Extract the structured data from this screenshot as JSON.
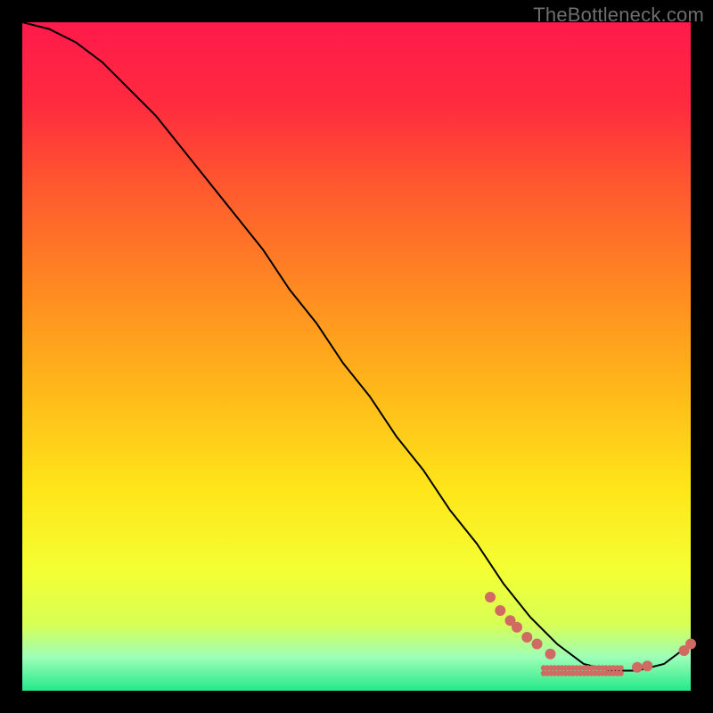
{
  "watermark": "TheBottleneck.com",
  "gradient": {
    "stops": [
      {
        "offset": 0.0,
        "color": "#ff1a4b"
      },
      {
        "offset": 0.12,
        "color": "#ff2a3f"
      },
      {
        "offset": 0.25,
        "color": "#ff5a2e"
      },
      {
        "offset": 0.4,
        "color": "#ff8a22"
      },
      {
        "offset": 0.55,
        "color": "#ffb81a"
      },
      {
        "offset": 0.7,
        "color": "#ffe61a"
      },
      {
        "offset": 0.82,
        "color": "#f4ff33"
      },
      {
        "offset": 0.9,
        "color": "#d8ff55"
      },
      {
        "offset": 0.95,
        "color": "#9dffb8"
      },
      {
        "offset": 1.0,
        "color": "#25e88a"
      }
    ]
  },
  "chart_data": {
    "type": "line",
    "title": "",
    "xlabel": "",
    "ylabel": "",
    "xlim": [
      0,
      100
    ],
    "ylim": [
      0,
      100
    ],
    "series": [
      {
        "name": "curve",
        "x": [
          0,
          4,
          8,
          12,
          16,
          20,
          24,
          28,
          32,
          36,
          40,
          44,
          48,
          52,
          56,
          60,
          64,
          68,
          72,
          76,
          80,
          84,
          88,
          92,
          96,
          100
        ],
        "y": [
          100,
          99,
          97,
          94,
          90,
          86,
          81,
          76,
          71,
          66,
          60,
          55,
          49,
          44,
          38,
          33,
          27,
          22,
          16,
          11,
          7,
          4,
          3,
          3,
          4,
          7
        ]
      }
    ],
    "markers": [
      {
        "x": 70.0,
        "y": 14.0
      },
      {
        "x": 71.5,
        "y": 12.0
      },
      {
        "x": 73.0,
        "y": 10.5
      },
      {
        "x": 74.0,
        "y": 9.5
      },
      {
        "x": 75.5,
        "y": 8.0
      },
      {
        "x": 77.0,
        "y": 7.0
      },
      {
        "x": 79.0,
        "y": 5.5
      },
      {
        "x": 92.0,
        "y": 3.5
      },
      {
        "x": 93.5,
        "y": 3.7
      },
      {
        "x": 99.0,
        "y": 6.0
      },
      {
        "x": 100.0,
        "y": 7.0
      }
    ],
    "label_cluster": {
      "text": "",
      "x": 84.0,
      "y": 3.0,
      "spread_x": 6.0
    }
  },
  "styles": {
    "line_color": "#000000",
    "line_width": 2,
    "marker_color": "#d16a63",
    "marker_radius_big": 6,
    "marker_radius_small": 3.2
  }
}
